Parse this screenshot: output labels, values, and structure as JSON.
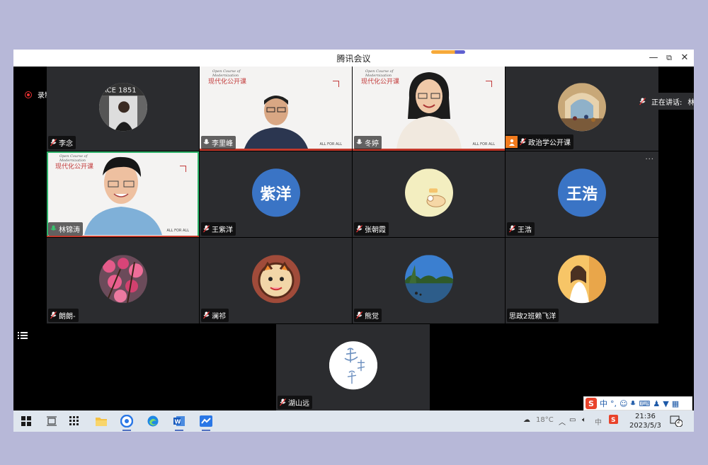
{
  "window": {
    "title": "腾讯会议",
    "controls": {
      "minimize": "—",
      "restore": "⧉",
      "close": "✕"
    }
  },
  "recording": {
    "label": "录制中"
  },
  "speaking": {
    "label": "正在讲话:",
    "name": "林"
  },
  "slide": {
    "course_en_1": "Open Course of",
    "course_en_2": "Modernization",
    "course_cn": "现代化公开课",
    "footer": "ALL FOR ALL"
  },
  "participants": [
    {
      "name": "李念",
      "kind": "photo"
    },
    {
      "name": "李里峰",
      "kind": "video"
    },
    {
      "name": "冬婷",
      "kind": "video"
    },
    {
      "name": "政治学公开课",
      "kind": "photo"
    },
    {
      "name": "林锦涛",
      "kind": "video"
    },
    {
      "name": "王紫洋",
      "kind": "text",
      "avatar_text": "紫洋"
    },
    {
      "name": "张朝霞",
      "kind": "photo"
    },
    {
      "name": "王浩",
      "kind": "text",
      "avatar_text": "王浩"
    },
    {
      "name": "朗朗-",
      "kind": "photo"
    },
    {
      "name": "澜祁",
      "kind": "photo"
    },
    {
      "name": "熊觉",
      "kind": "photo"
    },
    {
      "name": "思政2班赖飞洋",
      "kind": "photo"
    },
    {
      "name": "湖山远",
      "kind": "photo"
    }
  ],
  "tile_menu": "···",
  "ime": {
    "mode": "中",
    "punct": "°,"
  },
  "taskbar": {
    "weather": "18°C",
    "ime_lang": "中",
    "time": "21:36",
    "date": "2023/5/3",
    "notifications": "2"
  },
  "colors": {
    "accent": "#3a74c5",
    "active_border": "#2fb26a",
    "record": "#e33333"
  }
}
